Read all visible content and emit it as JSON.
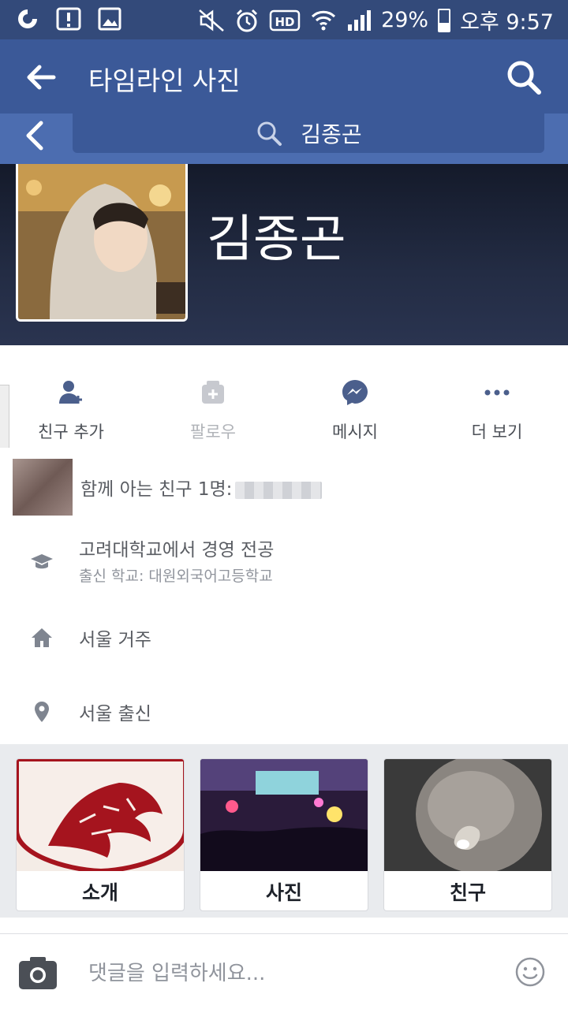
{
  "status_bar": {
    "battery": "29%",
    "time": "오후 9:57",
    "icons": [
      "app-icon",
      "alert-icon",
      "image-icon",
      "mute-icon",
      "alarm-icon",
      "hd-icon",
      "wifi-icon",
      "signal-icon",
      "battery-icon"
    ]
  },
  "app_bar": {
    "title": "타임라인 사진"
  },
  "search": {
    "query": "김종곤"
  },
  "profile": {
    "name": "김종곤"
  },
  "actions": [
    {
      "label": "친구 추가",
      "icon": "add-friend-icon"
    },
    {
      "label": "팔로우",
      "icon": "follow-icon"
    },
    {
      "label": "메시지",
      "icon": "messenger-icon"
    },
    {
      "label": "더 보기",
      "icon": "more-icon"
    }
  ],
  "info": {
    "mutual": "함께 아는 친구 1명:",
    "education": {
      "main": "고려대학교에서 경영 전공",
      "sub": "출신 학교: 대원외국어고등학교"
    },
    "lives": "서울 거주",
    "from": "서울 출신"
  },
  "tiles": [
    {
      "label": "소개"
    },
    {
      "label": "사진"
    },
    {
      "label": "친구"
    }
  ],
  "comment": {
    "placeholder": "댓글을 입력하세요..."
  },
  "colors": {
    "brand": "#3b5998",
    "status_bar": "#334a7a",
    "search_strip": "#4c6db0"
  }
}
